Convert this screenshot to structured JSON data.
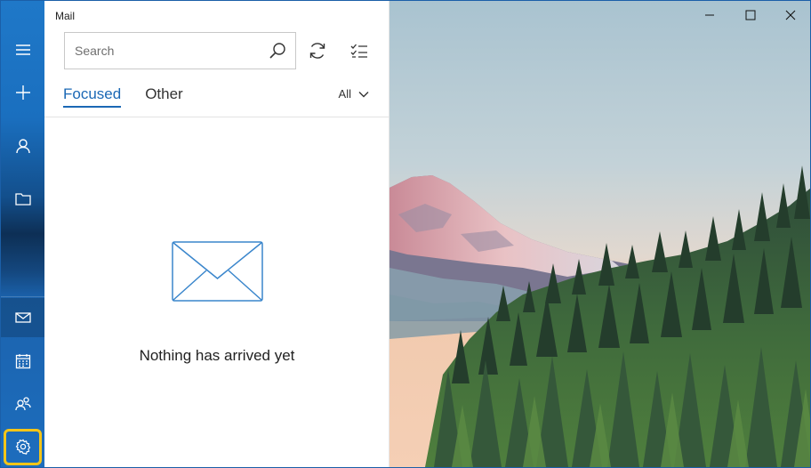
{
  "app": {
    "title": "Mail"
  },
  "search": {
    "placeholder": "Search"
  },
  "toolbar": {
    "sync_icon": "sync-icon",
    "select_icon": "selection-mode-icon"
  },
  "tabs": [
    {
      "label": "Focused",
      "active": true
    },
    {
      "label": "Other",
      "active": false
    }
  ],
  "filter": {
    "label": "All"
  },
  "empty_state": {
    "message": "Nothing has arrived yet",
    "icon": "envelope-icon"
  },
  "rail": {
    "items": [
      "hamburger-icon",
      "compose-icon",
      "account-icon",
      "folder-icon",
      "mail-icon",
      "calendar-icon",
      "people-icon",
      "settings-icon"
    ],
    "highlighted": "settings-icon",
    "highlight_color": "#f5c518"
  },
  "window_controls": [
    "minimize-icon",
    "maximize-icon",
    "close-icon"
  ],
  "colors": {
    "accent": "#1b68b5",
    "rail": "#1a6fbf"
  }
}
